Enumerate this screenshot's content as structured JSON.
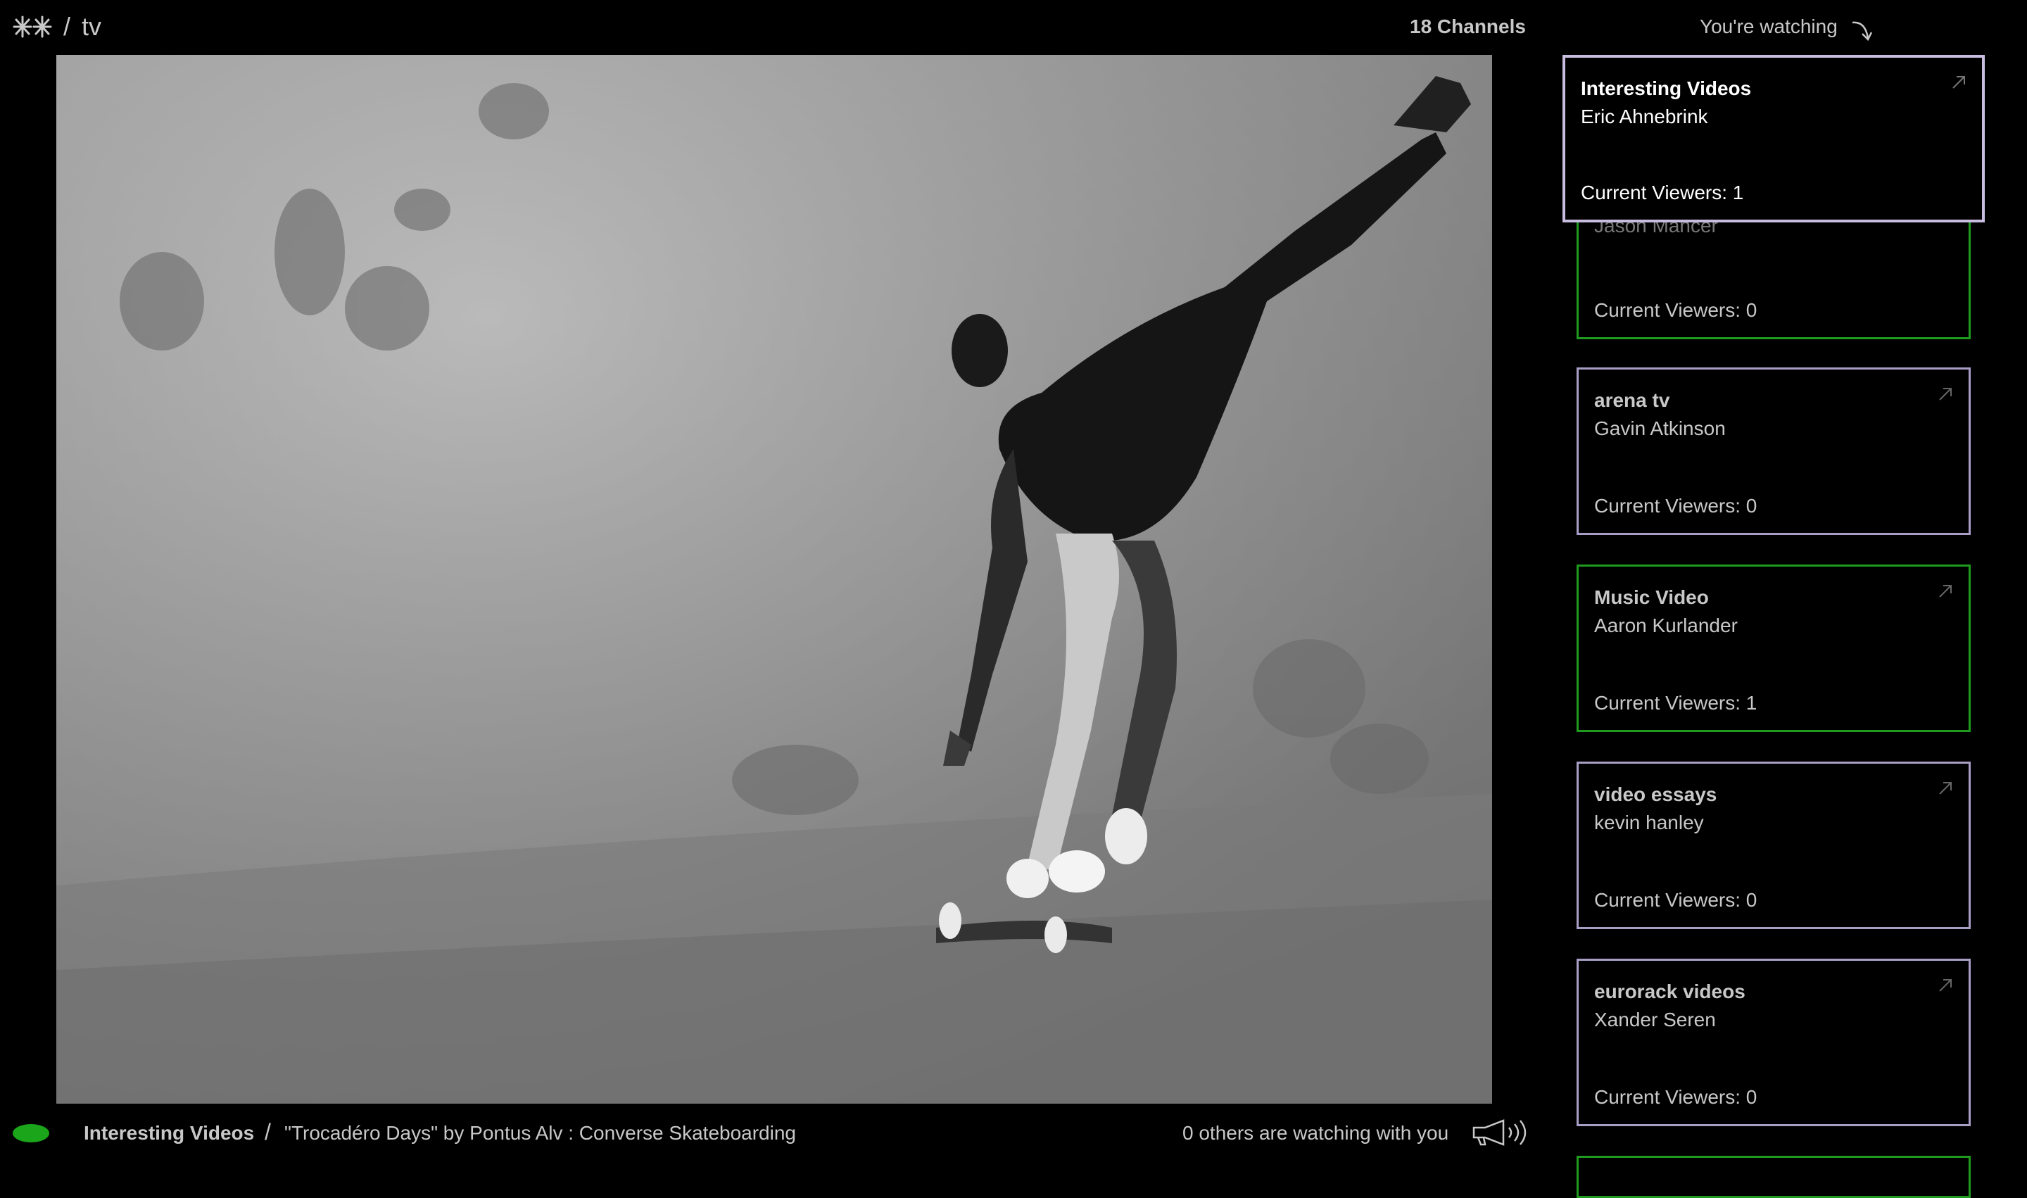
{
  "header": {
    "logo_icon": "asterisks-logo-icon",
    "separator": "/",
    "section": "tv",
    "channels_count": "18 Channels",
    "watching_label": "You're watching",
    "watching_icon": "curved-arrow-down-icon"
  },
  "player": {
    "description": "black-and-white video frame of a skateboarder leaning on a ramp"
  },
  "now_playing": {
    "live_indicator_color": "#1aa51a",
    "channel": "Interesting Videos",
    "separator": "/",
    "title": "\"Trocadéro Days\" by Pontus Alv : Converse Skateboarding",
    "others_watching": "0 others are watching with you",
    "sound_icon": "megaphone-sound-icon"
  },
  "colors": {
    "active_border": "#c8bde0",
    "green_border": "#1f9a1f",
    "lilac_border": "#a99fc6"
  },
  "channels": {
    "active": {
      "title": "Interesting Videos",
      "owner": "Eric Ahnebrink",
      "viewers": "Current Viewers: 1"
    },
    "list": [
      {
        "title": "",
        "owner": "Jason Mancer",
        "viewers": "Current Viewers: 0"
      },
      {
        "title": "arena tv",
        "owner": "Gavin Atkinson",
        "viewers": "Current Viewers: 0"
      },
      {
        "title": "Music Video",
        "owner": "Aaron Kurlander",
        "viewers": "Current Viewers: 1"
      },
      {
        "title": "video essays",
        "owner": "kevin hanley",
        "viewers": "Current Viewers: 0"
      },
      {
        "title": "eurorack videos",
        "owner": "Xander Seren",
        "viewers": "Current Viewers: 0"
      }
    ]
  }
}
